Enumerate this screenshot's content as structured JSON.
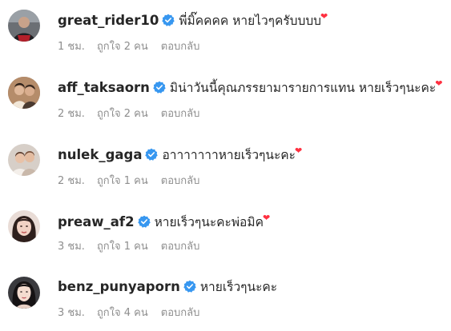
{
  "colors": {
    "text_primary": "#262626",
    "text_secondary": "#8e8e8e",
    "verified_blue": "#3797f0",
    "heart_red": "#ff3040"
  },
  "icons": {
    "verified": "verified-badge-icon",
    "heart": "heart-emoji"
  },
  "comments": [
    {
      "username": "great_rider10",
      "verified": true,
      "text": "พี่มิ๊คคคค หายไวๆครับบบบ",
      "emoji": "❤",
      "time": "1 ชม.",
      "likes": "ถูกใจ 2 คน",
      "reply": "ตอบกลับ"
    },
    {
      "username": "aff_taksaorn",
      "verified": true,
      "text": "มิน่าวันนี้คุณภรรยามารายการแทน หายเร็วๆนะคะ",
      "emoji": "❤",
      "time": "2 ชม.",
      "likes": "ถูกใจ 2 คน",
      "reply": "ตอบกลับ"
    },
    {
      "username": "nulek_gaga",
      "verified": true,
      "text": "อาาาาาาาหายเร็วๆนะคะ",
      "emoji": "❤",
      "time": "2 ชม.",
      "likes": "ถูกใจ 1 คน",
      "reply": "ตอบกลับ"
    },
    {
      "username": "preaw_af2",
      "verified": true,
      "text": "หายเร็วๆนะคะพ่อมิค",
      "emoji": "❤",
      "time": "3 ชม.",
      "likes": "ถูกใจ 1 คน",
      "reply": "ตอบกลับ"
    },
    {
      "username": "benz_punyaporn",
      "verified": true,
      "text": "หายเร็วๆนะคะ",
      "emoji": "",
      "time": "3 ชม.",
      "likes": "ถูกใจ 4 คน",
      "reply": "ตอบกลับ"
    }
  ]
}
